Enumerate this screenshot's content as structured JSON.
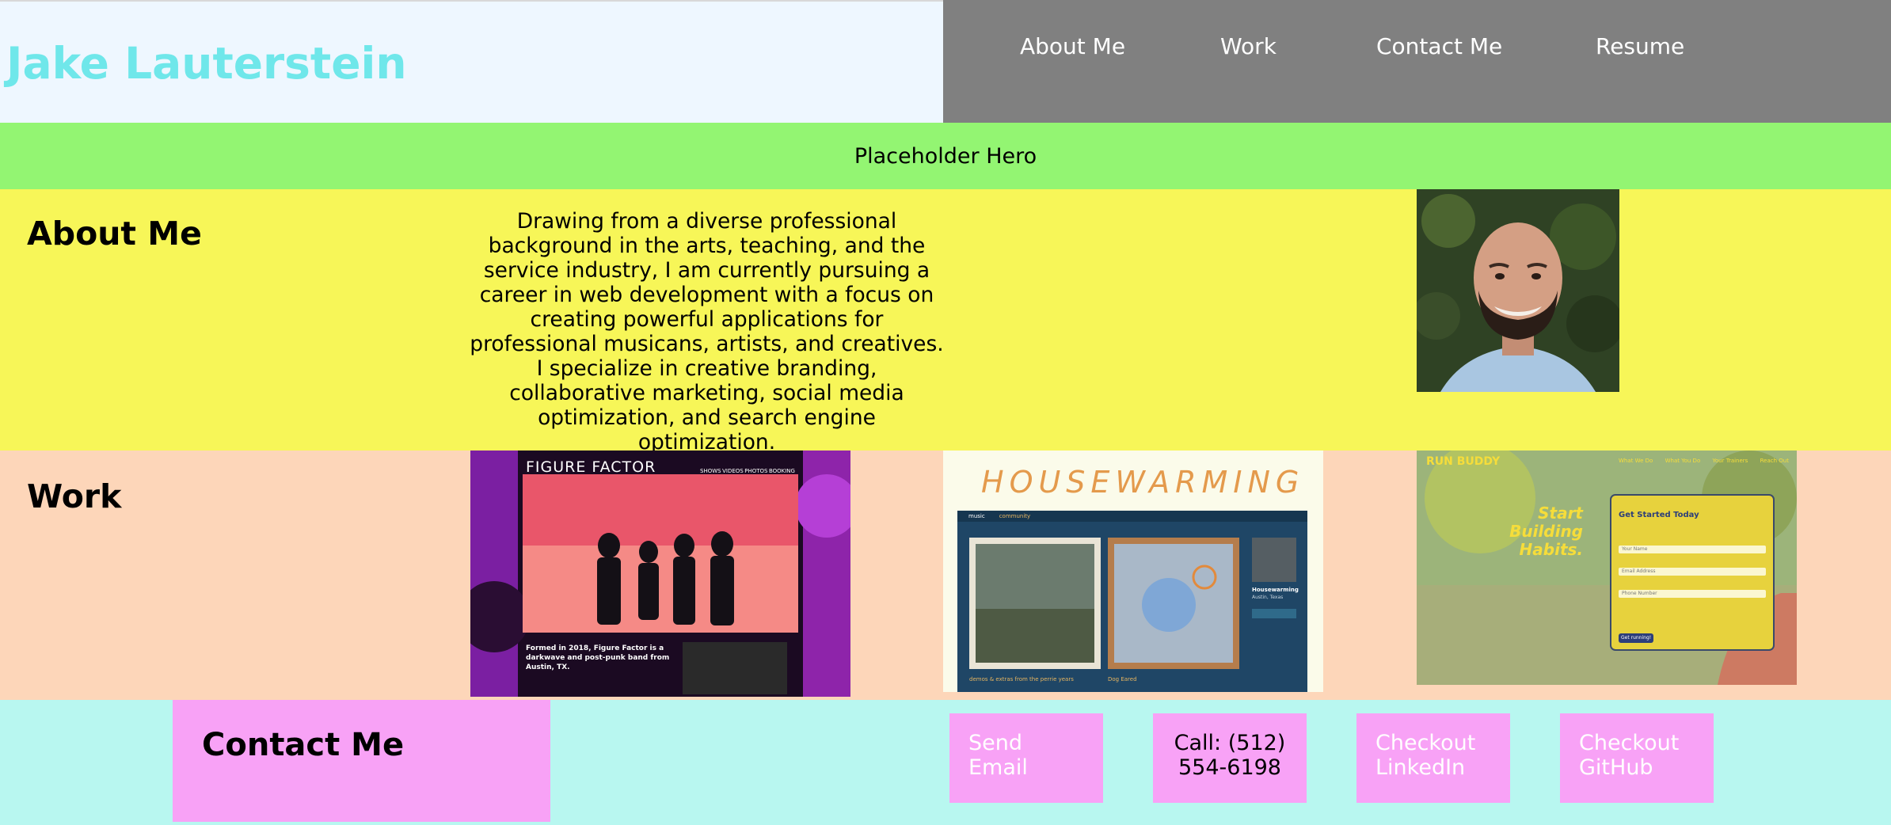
{
  "header": {
    "title": "Jake Lauterstein",
    "nav": [
      "About Me",
      "Work",
      "Contact Me",
      "Resume"
    ]
  },
  "hero": {
    "text": "Placeholder Hero"
  },
  "about": {
    "heading": "About Me",
    "body": "Drawing from a diverse professional background in the arts, teaching, and the service industry, I am currently pursuing a career in web development with a focus on creating powerful applications for professional musicans, artists, and creatives. I specialize in creative branding, collaborative marketing, social media optimization, and search engine optimization."
  },
  "work": {
    "heading": "Work",
    "projects": [
      {
        "name": "FIGURE FACTOR",
        "nav": [
          "SHOWS",
          "VIDEOS",
          "PHOTOS",
          "BOOKING"
        ],
        "caption": "Formed in 2018, Figure Factor is a darkwave and post-punk band from Austin, TX."
      },
      {
        "name": "HOUSEWARMING",
        "tabs": [
          "music",
          "community"
        ],
        "album1": "demos & extras from the perrie years",
        "album2": "Dog Eared",
        "artist": "Housewarming",
        "location": "Austin, Texas"
      },
      {
        "name": "RUN BUDDY",
        "nav": [
          "What We Do",
          "What You Do",
          "Your Trainers",
          "Reach Out"
        ],
        "tagline": "Start Building Habits.",
        "form_title": "Get Started Today",
        "fields": [
          "Your Name",
          "Email Address",
          "Phone Number"
        ],
        "button": "Get running!"
      }
    ]
  },
  "contact": {
    "heading": "Contact Me",
    "buttons": [
      "Send Email",
      "Call: (512) 554-6198",
      "Checkout LinkedIn",
      "Checkout GitHub"
    ]
  },
  "colors": {
    "title": "#6fe7ea",
    "nav_bg": "#808080",
    "hero_bg": "#93f572",
    "about_bg": "#f7f658",
    "work_bg": "#fdd6b9",
    "contact_bg": "#b8f7f0",
    "contact_accent": "#f8a2f6"
  }
}
